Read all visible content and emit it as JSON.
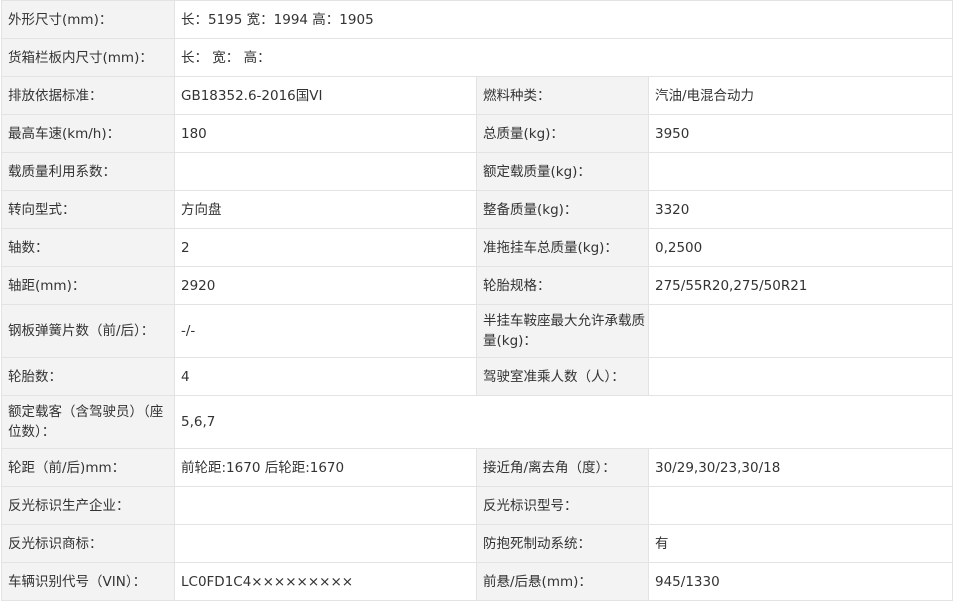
{
  "rows": [
    {
      "type": "full",
      "label": "外形尺寸(mm)：",
      "value": "长：5195 宽：1994 高：1905"
    },
    {
      "type": "full",
      "label": "货箱栏板内尺寸(mm)：",
      "value": "长： 宽： 高："
    },
    {
      "type": "pair",
      "label1": "排放依据标准：",
      "value1": "GB18352.6-2016国VI",
      "label2": "燃料种类：",
      "value2": "汽油/电混合动力"
    },
    {
      "type": "pair",
      "label1": "最高车速(km/h)：",
      "value1": "180",
      "label2": "总质量(kg)：",
      "value2": "3950"
    },
    {
      "type": "pair",
      "label1": "载质量利用系数：",
      "value1": "",
      "label2": "额定载质量(kg)：",
      "value2": ""
    },
    {
      "type": "pair",
      "label1": "转向型式：",
      "value1": "方向盘",
      "label2": "整备质量(kg)：",
      "value2": "3320"
    },
    {
      "type": "pair",
      "label1": "轴数：",
      "value1": "2",
      "label2": "准拖挂车总质量(kg)：",
      "value2": "0,2500"
    },
    {
      "type": "pair",
      "label1": "轴距(mm)：",
      "value1": "2920",
      "label2": "轮胎规格：",
      "value2": "275/55R20,275/50R21"
    },
    {
      "type": "pair",
      "label1": "钢板弹簧片数（前/后）：",
      "value1": "-/-",
      "label2": "半挂车鞍座最大允许承载质量(kg)：",
      "value2": ""
    },
    {
      "type": "pair",
      "label1": "轮胎数：",
      "value1": "4",
      "label2": "驾驶室准乘人数（人）：",
      "value2": ""
    },
    {
      "type": "full",
      "label": "额定载客（含驾驶员）（座位数）：",
      "value": "5,6,7"
    },
    {
      "type": "pair",
      "label1": "轮距（前/后)mm：",
      "value1": "前轮距:1670 后轮距:1670",
      "label2": "接近角/离去角（度）：",
      "value2": "30/29,30/23,30/18"
    },
    {
      "type": "pair",
      "label1": "反光标识生产企业：",
      "value1": "",
      "label2": "反光标识型号：",
      "value2": ""
    },
    {
      "type": "pair",
      "label1": "反光标识商标：",
      "value1": "",
      "label2": "防抱死制动系统：",
      "value2": "有"
    },
    {
      "type": "pair",
      "label1": "车辆识别代号（VIN）：",
      "value1": "LC0FD1C4×××××××××",
      "label2": "前悬/后悬(mm)：",
      "value2": "945/1330"
    }
  ]
}
